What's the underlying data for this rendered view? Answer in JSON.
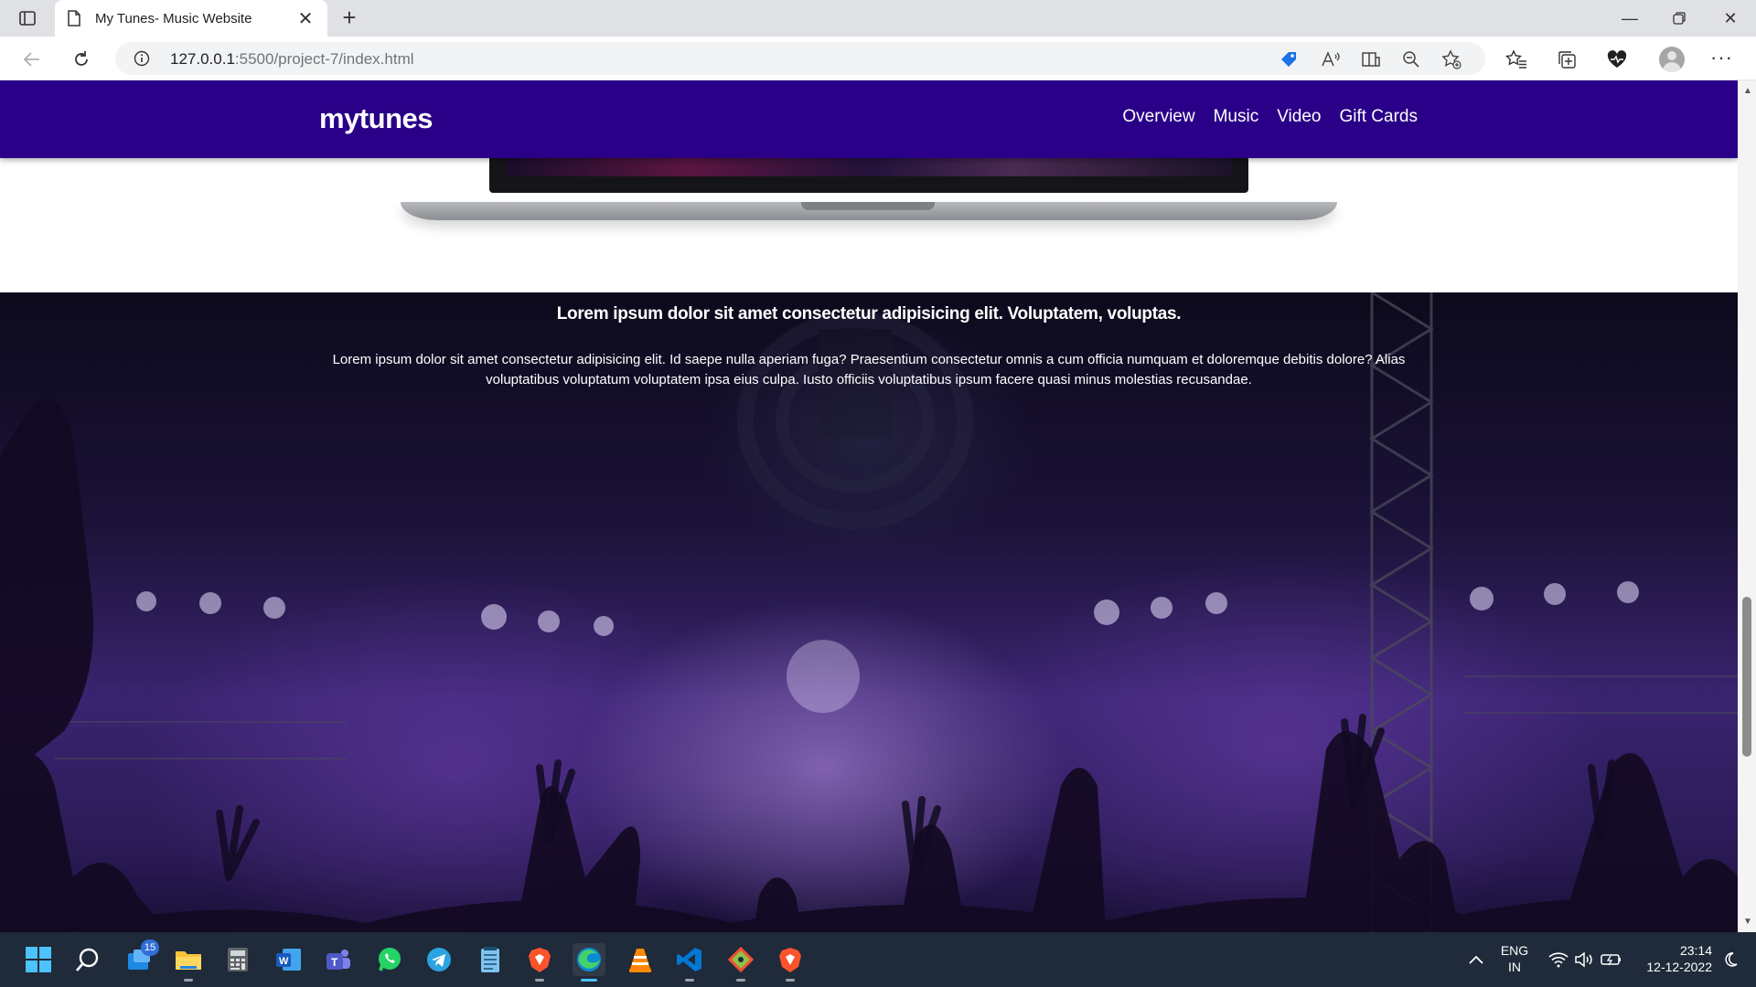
{
  "browser": {
    "tab_title": "My Tunes- Music Website",
    "url_host": "127.0.0.1",
    "url_rest": ":5500/project-7/index.html"
  },
  "site": {
    "brand": "mytunes",
    "nav": [
      "Overview",
      "Music",
      "Video",
      "Gift Cards"
    ],
    "accent_color": "#2a0088"
  },
  "hero": {
    "heading": "Lorem ipsum dolor sit amet consectetur adipisicing elit. Voluptatem, voluptas.",
    "paragraph": "Lorem ipsum dolor sit amet consectetur adipisicing elit. Id saepe nulla aperiam fuga? Praesentium consectetur omnis a cum officia numquam et doloremque debitis dolore? Alias voluptatibus voluptatum voluptatem ipsa eius culpa. Iusto officiis voluptatibus ipsum facere quasi minus molestias recusandae."
  },
  "taskbar": {
    "mail_badge": "15",
    "language_line1": "ENG",
    "language_line2": "IN",
    "time": "23:14",
    "date": "12-12-2022",
    "apps": [
      "start-icon",
      "search-icon",
      "mail-icon",
      "file-explorer-icon",
      "calculator-icon",
      "word-icon",
      "teams-icon",
      "whatsapp-icon",
      "telegram-icon",
      "notepad-icon",
      "brave-icon",
      "edge-icon",
      "vlc-icon",
      "vscode-icon",
      "git-icon",
      "brave-icon"
    ]
  }
}
